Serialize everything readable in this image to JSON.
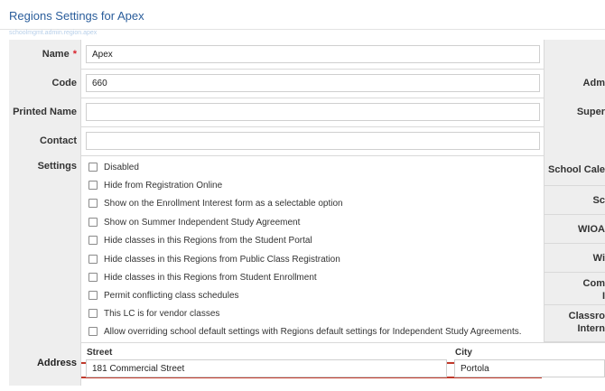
{
  "header": {
    "title": "Regions Settings for Apex",
    "subtitle": "schoolmgmt.admin.region.apex"
  },
  "form": {
    "name_label": "Name",
    "name_value": "Apex",
    "required_mark": "*",
    "code_label": "Code",
    "code_value": "660",
    "printed_name_label": "Printed Name",
    "printed_name_value": "",
    "contact_label": "Contact",
    "contact_value": "",
    "settings_label": "Settings",
    "settings": [
      {
        "label": "Disabled",
        "checked": false
      },
      {
        "label": "Hide from Registration Online",
        "checked": false
      },
      {
        "label": "Show on the Enrollment Interest form as a selectable option",
        "checked": false
      },
      {
        "label": "Show on Summer Independent Study Agreement",
        "checked": false
      },
      {
        "label": "Hide classes in this Regions from the Student Portal",
        "checked": false
      },
      {
        "label": "Hide classes in this Regions from Public Class Registration",
        "checked": false
      },
      {
        "label": "Hide classes in this Regions from Student Enrollment",
        "checked": false
      },
      {
        "label": "Permit conflicting class schedules",
        "checked": false
      },
      {
        "label": "This LC is for vendor classes",
        "checked": false
      },
      {
        "label": "Allow overriding school default settings with Regions default settings for Independent Study Agreements.",
        "checked": false
      }
    ],
    "address_label": "Address",
    "street_label": "Street",
    "street_value": "181 Commercial Street",
    "city_label": "City",
    "city_value": "Portola"
  },
  "right_column": {
    "adm": "Adm",
    "super": "Super",
    "school_cale": "School Cale",
    "sc": "Sc",
    "wioa": "WIOA",
    "wi": "Wi",
    "com": "Com",
    "com2": "I",
    "classro": "Classro",
    "intern": "Intern"
  },
  "colors": {
    "title": "#2a5d9b",
    "highlight": "#c0392b",
    "label_bg": "#eeeeee"
  }
}
